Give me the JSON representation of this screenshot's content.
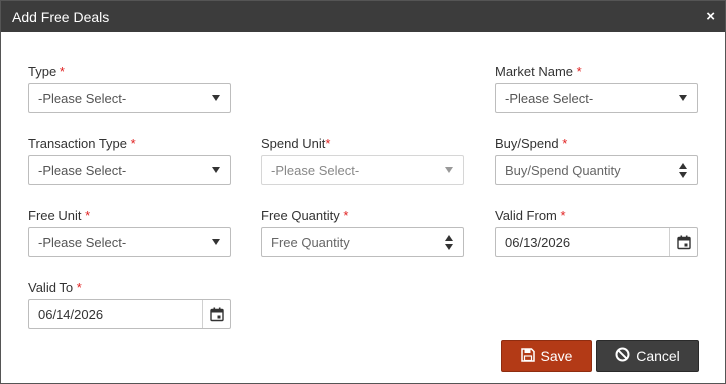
{
  "dialog": {
    "title": "Add Free Deals",
    "close_glyph": "×"
  },
  "fields": {
    "type": {
      "label": "Type",
      "required_mark": "*",
      "value": "-Please Select-"
    },
    "market_name": {
      "label": "Market Name",
      "required_mark": "*",
      "value": "-Please Select-"
    },
    "transaction_type": {
      "label": "Transaction Type",
      "required_mark": "*",
      "value": "-Please Select-"
    },
    "spend_unit": {
      "label": "Spend Unit",
      "required_mark": "*",
      "value": "-Please Select-",
      "disabled": true
    },
    "buy_spend": {
      "label": "Buy/Spend",
      "required_mark": "*",
      "placeholder": "Buy/Spend Quantity"
    },
    "free_unit": {
      "label": "Free Unit",
      "required_mark": "*",
      "value": "-Please Select-"
    },
    "free_quantity": {
      "label": "Free Quantity",
      "required_mark": "*",
      "placeholder": "Free Quantity"
    },
    "valid_from": {
      "label": "Valid From",
      "required_mark": "*",
      "value": "06/13/2026"
    },
    "valid_to": {
      "label": "Valid To",
      "required_mark": "*",
      "value": "06/14/2026"
    }
  },
  "buttons": {
    "save": {
      "label": "Save",
      "icon": "floppy-disk-icon"
    },
    "cancel": {
      "label": "Cancel",
      "icon": "ban-icon"
    }
  },
  "colors": {
    "titlebar": "#3c3c3c",
    "save": "#b33a16",
    "cancel": "#3f3f3f",
    "required": "#e02020"
  }
}
